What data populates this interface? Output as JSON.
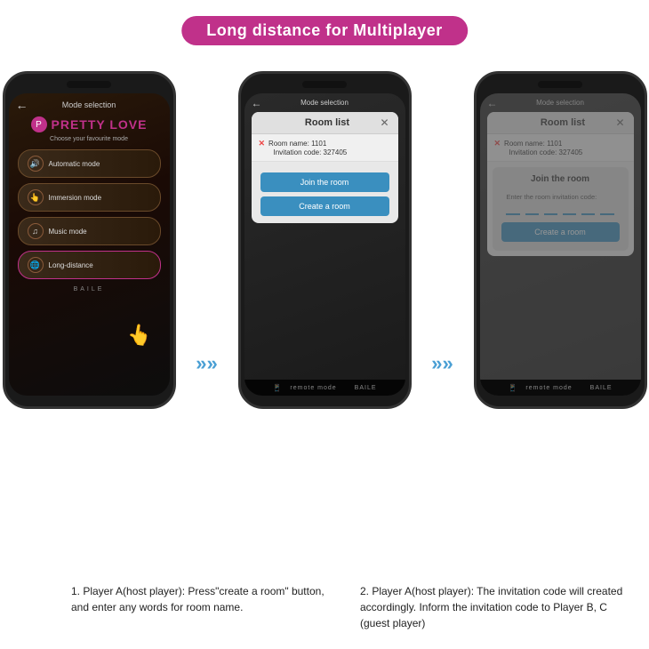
{
  "title": "Long distance for Multiplayer",
  "phone1": {
    "header": "Mode selection",
    "logo": "PRETTY LOVE",
    "choose_label": "Choose your favourite mode",
    "modes": [
      {
        "icon": "🔊",
        "label": "Automatic mode"
      },
      {
        "icon": "👆",
        "label": "Immersion mode"
      },
      {
        "icon": "♫",
        "label": "Music mode"
      },
      {
        "icon": "🌐",
        "label": "Long-distance"
      }
    ],
    "baile": "BAILE"
  },
  "phone2": {
    "header": "Mode selection",
    "room_list_title": "Room list",
    "room_name": "Room name: 1101",
    "invitation_code": "Invitation code: 327405",
    "join_btn": "Join the room",
    "create_btn": "Create a room",
    "remote_mode": "remote mode",
    "baile": "BAILE"
  },
  "phone3": {
    "header": "Mode selection",
    "room_list_title": "Room list",
    "room_name": "Room name: 1101",
    "invitation_code": "Invitation code: 327405",
    "join_title": "Join the room",
    "enter_label": "Enter the room invitation code:",
    "create_btn": "Create a room",
    "remote_mode": "remote mode",
    "baile": "BAILE"
  },
  "desc1": {
    "text": "1. Player A(host player): Press\"create a room\" button, and enter any words for room name."
  },
  "desc2": {
    "text": "2. Player A(host player): The invitation code will created accordingly. Inform the invitation code to Player B, C (guest player)"
  }
}
